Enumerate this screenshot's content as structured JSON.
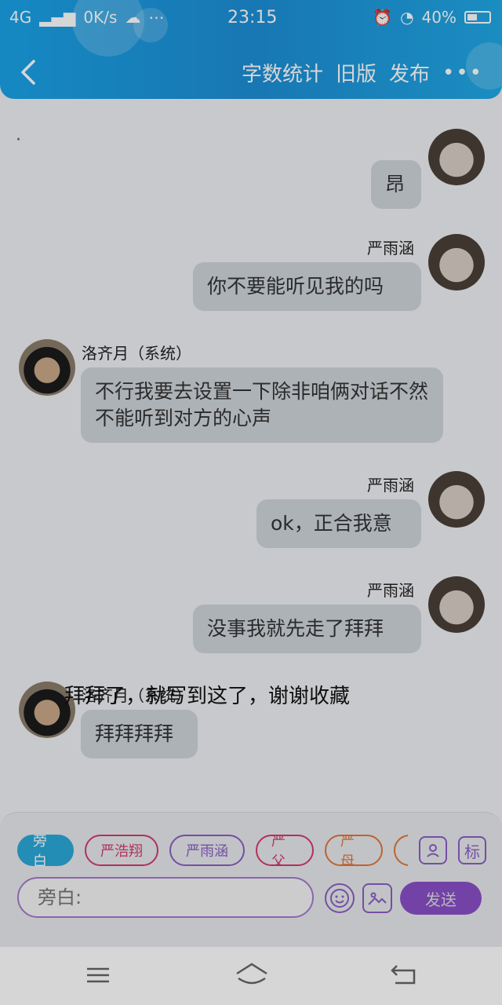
{
  "status_bar": {
    "network": "4G",
    "speed": "0K/s",
    "time": "23:15",
    "battery": "40%"
  },
  "header": {
    "actions": [
      "字数统计",
      "旧版",
      "发布"
    ],
    "more": "•••"
  },
  "chat": {
    "dot": "·",
    "messages": [
      {
        "side": "right",
        "name": "",
        "text": "昂"
      },
      {
        "side": "right",
        "name": "严雨涵",
        "text": "你不要能听见我的吗"
      },
      {
        "side": "left",
        "name": "洛齐月（系统）",
        "text": "不行我要去设置一下除非咱俩对话不然不能听到对方的心声"
      },
      {
        "side": "right",
        "name": "严雨涵",
        "text": "ok，正合我意"
      },
      {
        "side": "right",
        "name": "严雨涵",
        "text": "没事我就先走了拜拜"
      },
      {
        "side": "left",
        "name": "洛齐月（系统）",
        "text": "拜拜拜拜"
      }
    ],
    "closing": "拜拜了，就写到这了，谢谢收藏"
  },
  "composer": {
    "chips": [
      "旁白",
      "严浩翔",
      "严雨涵",
      "严父",
      "严母",
      ""
    ],
    "icon_labels": {
      "tag": "标"
    },
    "input_placeholder": "旁白:",
    "send": "发送"
  },
  "colors": {
    "header": "#1d8fd6",
    "bubble": "#cfd4db",
    "send": "#8a4fc7",
    "narrator_chip": "#2ba8d9"
  }
}
